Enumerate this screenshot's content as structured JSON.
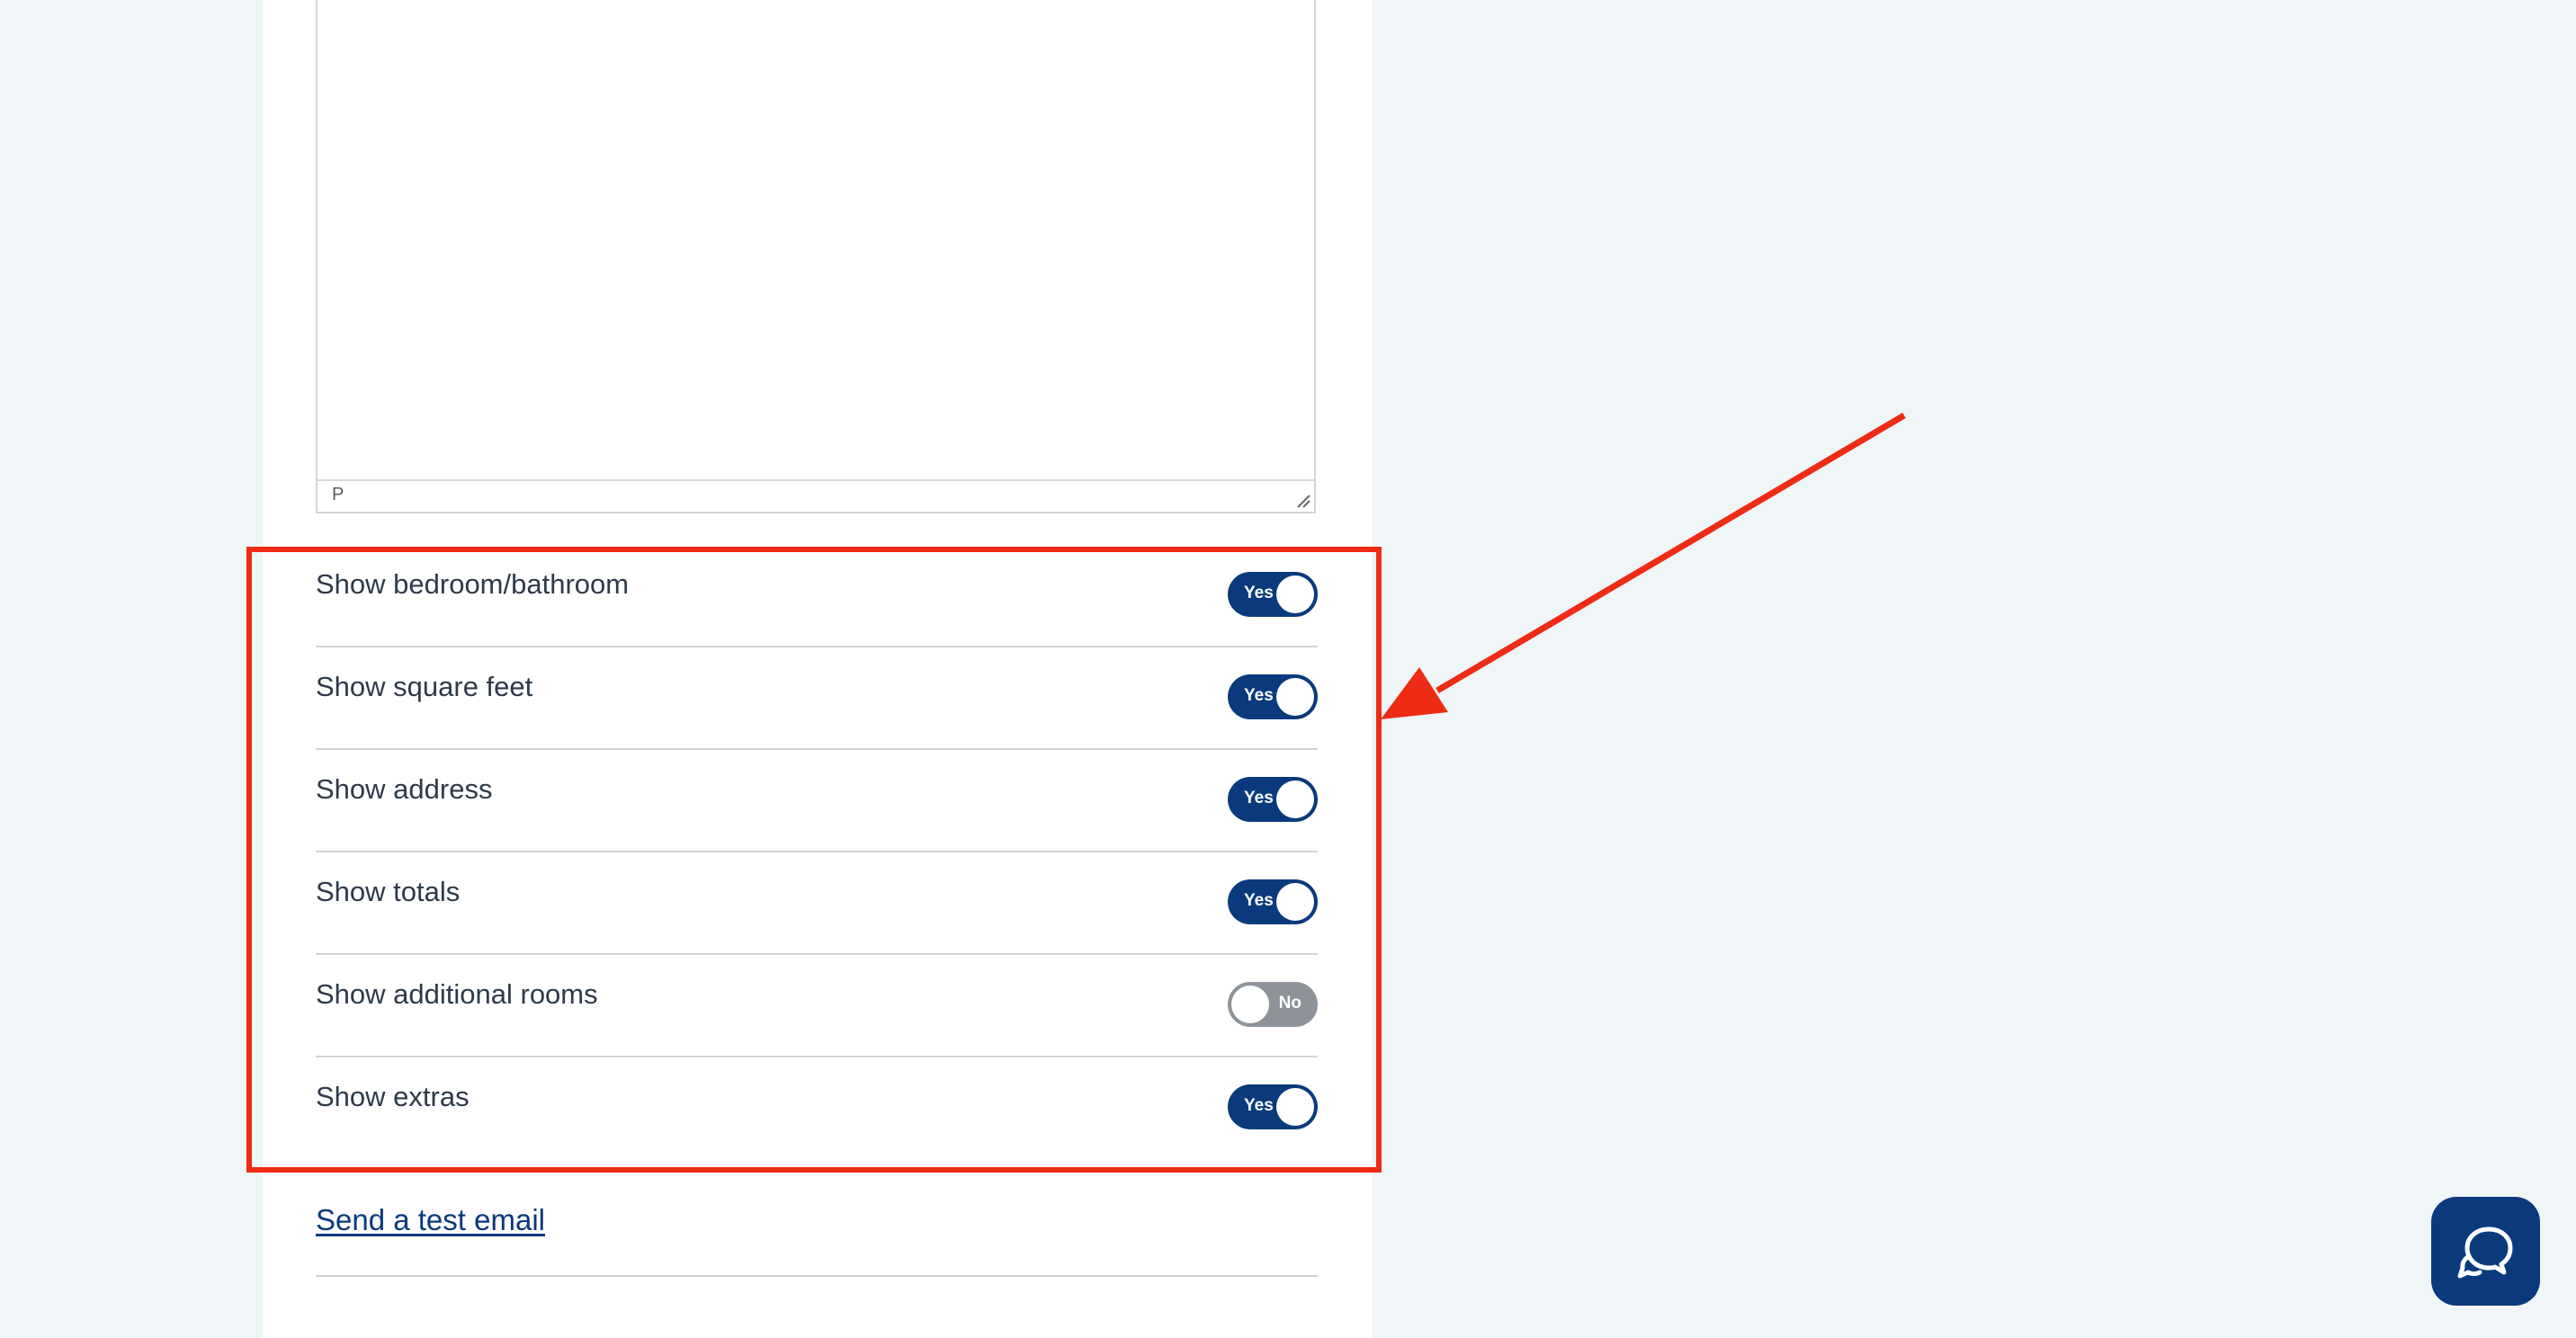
{
  "editor": {
    "status_path": "P"
  },
  "settings": [
    {
      "label": "Show bedroom/bathroom",
      "state": "Yes",
      "on": true
    },
    {
      "label": "Show square feet",
      "state": "Yes",
      "on": true
    },
    {
      "label": "Show address",
      "state": "Yes",
      "on": true
    },
    {
      "label": "Show totals",
      "state": "Yes",
      "on": true
    },
    {
      "label": "Show additional rooms",
      "state": "No",
      "on": false
    },
    {
      "label": "Show extras",
      "state": "Yes",
      "on": true
    }
  ],
  "test_email_link": "Send a test email",
  "colors": {
    "page_background": "#f0f5f8",
    "toggle_on": "#0a3a7c",
    "toggle_off": "#8d9399",
    "annotation_red": "#ee2b14",
    "link": "#0a3a7c"
  },
  "icons": {
    "chat": "chat-bubbles-icon",
    "resize": "resize-handle-icon"
  }
}
